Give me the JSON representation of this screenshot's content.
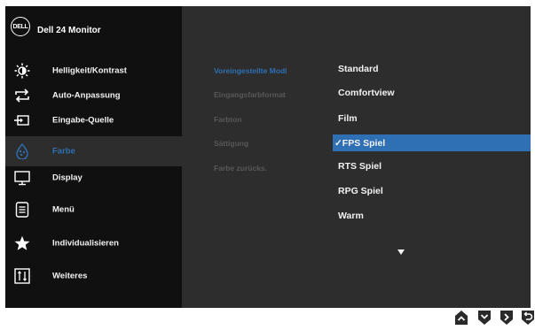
{
  "header": {
    "logo_text": "DELL",
    "title": "Dell 24 Monitor"
  },
  "sidebar": {
    "items": [
      {
        "label": "Helligkeit/Kontrast",
        "icon": "brightness-icon"
      },
      {
        "label": "Auto-Anpassung",
        "icon": "auto-adjust-icon"
      },
      {
        "label": "Eingabe-Quelle",
        "icon": "input-source-icon"
      },
      {
        "label": "Farbe",
        "icon": "color-icon",
        "active": true
      },
      {
        "label": "Display",
        "icon": "display-icon"
      },
      {
        "label": "Menü",
        "icon": "menu-icon"
      },
      {
        "label": "Individualisieren",
        "icon": "star-icon"
      },
      {
        "label": "Weiteres",
        "icon": "others-icon"
      }
    ]
  },
  "submenu": {
    "items": [
      {
        "label": "Voreingestellte Modi",
        "active": true
      },
      {
        "label": "Eingangsfarbformat"
      },
      {
        "label": "Farbton"
      },
      {
        "label": "Sättigung"
      },
      {
        "label": "Farbe zurücks."
      }
    ]
  },
  "options": {
    "items": [
      {
        "label": "Standard"
      },
      {
        "label": "Comfortview"
      },
      {
        "label": "Film"
      },
      {
        "label": "✓FPS Spiel",
        "selected": true
      },
      {
        "label": "RTS Spiel"
      },
      {
        "label": "RPG Spiel"
      },
      {
        "label": "Warm"
      }
    ],
    "more_indicator": "scroll-down-arrow-icon"
  },
  "buttons": [
    "up-button-icon",
    "down-button-icon",
    "select-button-icon",
    "back-button-icon"
  ],
  "colors": {
    "accent": "#2f6fb3",
    "panel": "#2d2d2d",
    "sidebar": "#101010"
  }
}
